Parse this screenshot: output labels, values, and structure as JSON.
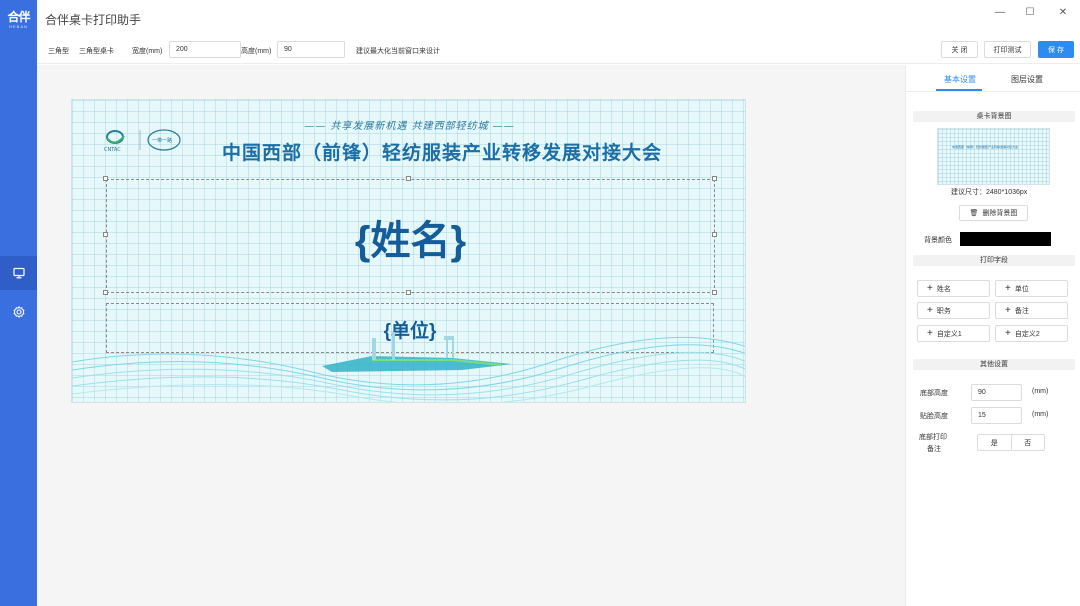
{
  "sidebar": {
    "logo": "合伴",
    "logo_sub": "HEBAN",
    "items": [
      {
        "name": "monitor-icon",
        "active": true
      },
      {
        "name": "gear-icon",
        "active": false
      }
    ]
  },
  "app": {
    "title": "合伴桌卡打印助手"
  },
  "window_controls": {
    "minimize": "—",
    "maximize": "☐",
    "close": "✕"
  },
  "toolbar": {
    "type_label": "三角型",
    "type_value": "三角型桌卡",
    "width_label": "宽度(mm)",
    "width_value": "200",
    "height_label": "高度(mm)",
    "height_value": "90",
    "hint": "建议最大化当前窗口来设计",
    "close_label": "关 闭",
    "test_print_label": "打印测试",
    "save_label": "保 存"
  },
  "card": {
    "slogan": "—— 共享发展新机遇  共建西部轻纺城 ——",
    "title": "中国西部（前锋）轻纺服装产业转移发展对接大会",
    "name_field": "{姓名}",
    "unit_field": "{单位}",
    "logo_text": "CNTAC",
    "logo2_text": "一带一路"
  },
  "right_panel": {
    "tabs": [
      "基本设置",
      "图层设置"
    ],
    "active_tab": 0,
    "bg_section": "桌卡背景图",
    "bg_size": "建议尺寸：2480*1036px",
    "delete_bg": "删除背景图",
    "bg_color_label": "背景颜色",
    "bg_color": "#000000",
    "fields_section": "打印字段",
    "fields": [
      "姓名",
      "单位",
      "职务",
      "备注",
      "自定义1",
      "自定义2"
    ],
    "other_section": "其他设置",
    "bottom_height_label": "底部高度",
    "bottom_height_value": "90",
    "bottom_height_unit": "(mm)",
    "fold_height_label": "贴脸高度",
    "fold_height_value": "15",
    "fold_height_unit": "(mm)",
    "bottom_print_label_1": "底部打印",
    "bottom_print_label_2": "备注",
    "yes": "是",
    "no": "否"
  }
}
